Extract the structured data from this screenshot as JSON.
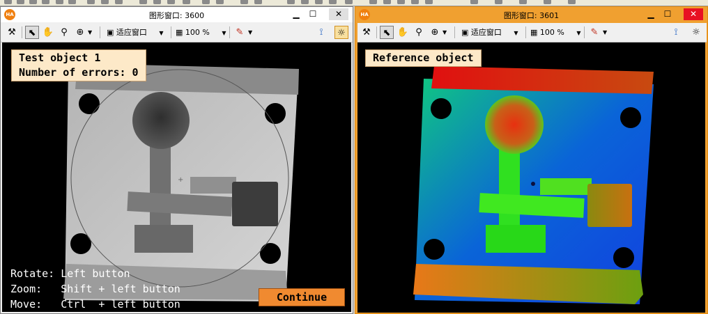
{
  "windows": {
    "left": {
      "title": "图形窗口: 3600",
      "logo": "HA",
      "minimize_icon": "minimize-icon",
      "maximize_icon": "maximize-icon",
      "close_symbol": "✕",
      "zoom_fit": "适应窗口",
      "zoom_percent": "100 %",
      "label_lines": [
        "Test object 1",
        "Number of errors: 0"
      ],
      "help_lines": [
        "Rotate: Left button",
        "Zoom:   Shift + left button",
        "Move:   Ctrl  + left button"
      ],
      "continue_label": "Continue"
    },
    "right": {
      "title": "图形窗口: 3601",
      "logo": "HA",
      "minimize_icon": "minimize-icon",
      "maximize_icon": "maximize-icon",
      "close_symbol": "✕",
      "zoom_fit": "适应窗口",
      "zoom_percent": "100 %",
      "label": "Reference object"
    }
  },
  "toolbar_icons": [
    "hammer-icon",
    "pointer-icon",
    "hand-icon",
    "magnifier-icon",
    "zoom-in-icon",
    "fit-window-icon",
    "zoom-percent-icon",
    "color-palette-icon",
    "axes-icon",
    "lightbulb-icon"
  ],
  "colors": {
    "active_title": "#f0a030",
    "continue_button": "#f08a30",
    "label_background": "#fde9c8"
  }
}
